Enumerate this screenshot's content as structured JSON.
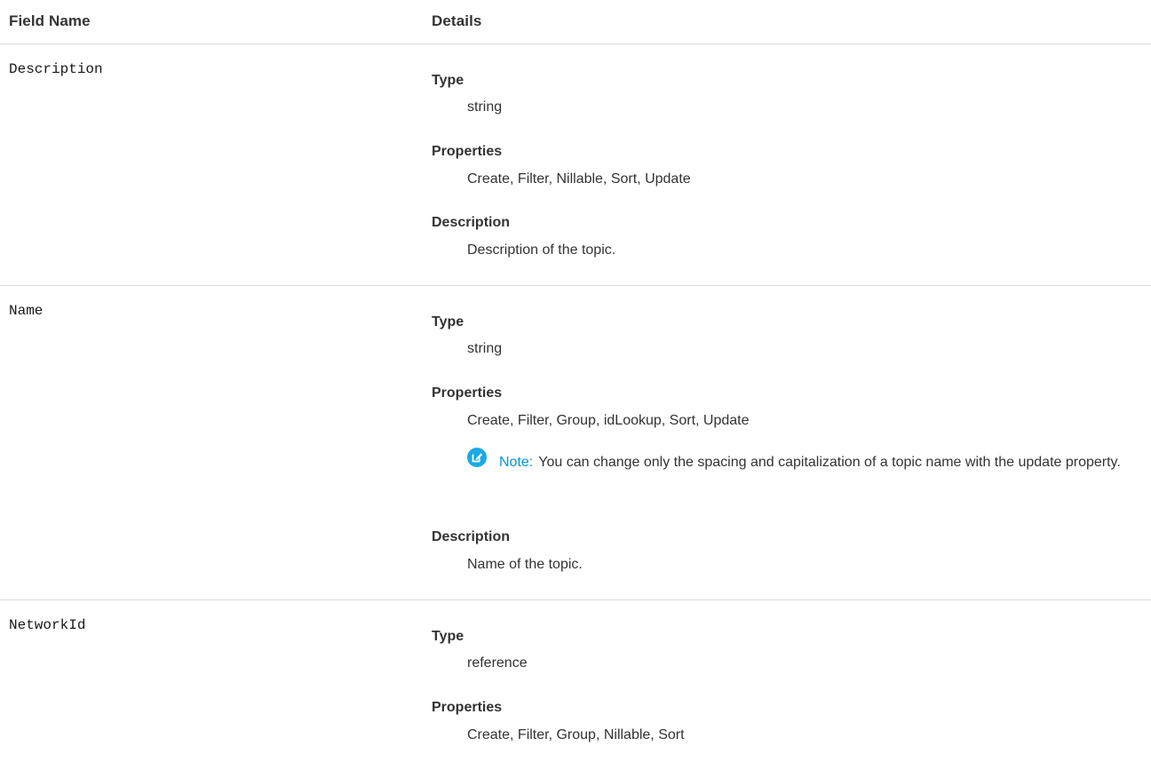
{
  "table": {
    "header": {
      "field_name": "Field Name",
      "details": "Details"
    },
    "rows": [
      {
        "field": "Description",
        "type_label": "Type",
        "type_value": "string",
        "properties_label": "Properties",
        "properties_value": "Create, Filter, Nillable, Sort, Update",
        "description_label": "Description",
        "description_value": "Description of the topic."
      },
      {
        "field": "Name",
        "type_label": "Type",
        "type_value": "string",
        "properties_label": "Properties",
        "properties_value": "Create, Filter, Group, idLookup, Sort, Update",
        "note_label": "Note:",
        "note_text": "You can change only the spacing and capitalization of a topic name with the update property.",
        "description_label": "Description",
        "description_value": "Name of the topic."
      },
      {
        "field": "NetworkId",
        "type_label": "Type",
        "type_value": "reference",
        "properties_label": "Properties",
        "properties_value": "Create, Filter, Group, Nillable, Sort"
      }
    ]
  },
  "colors": {
    "note_accent": "#0096d6",
    "divider": "#d8d8d8"
  },
  "icons": {
    "note": "edit-note-icon"
  }
}
